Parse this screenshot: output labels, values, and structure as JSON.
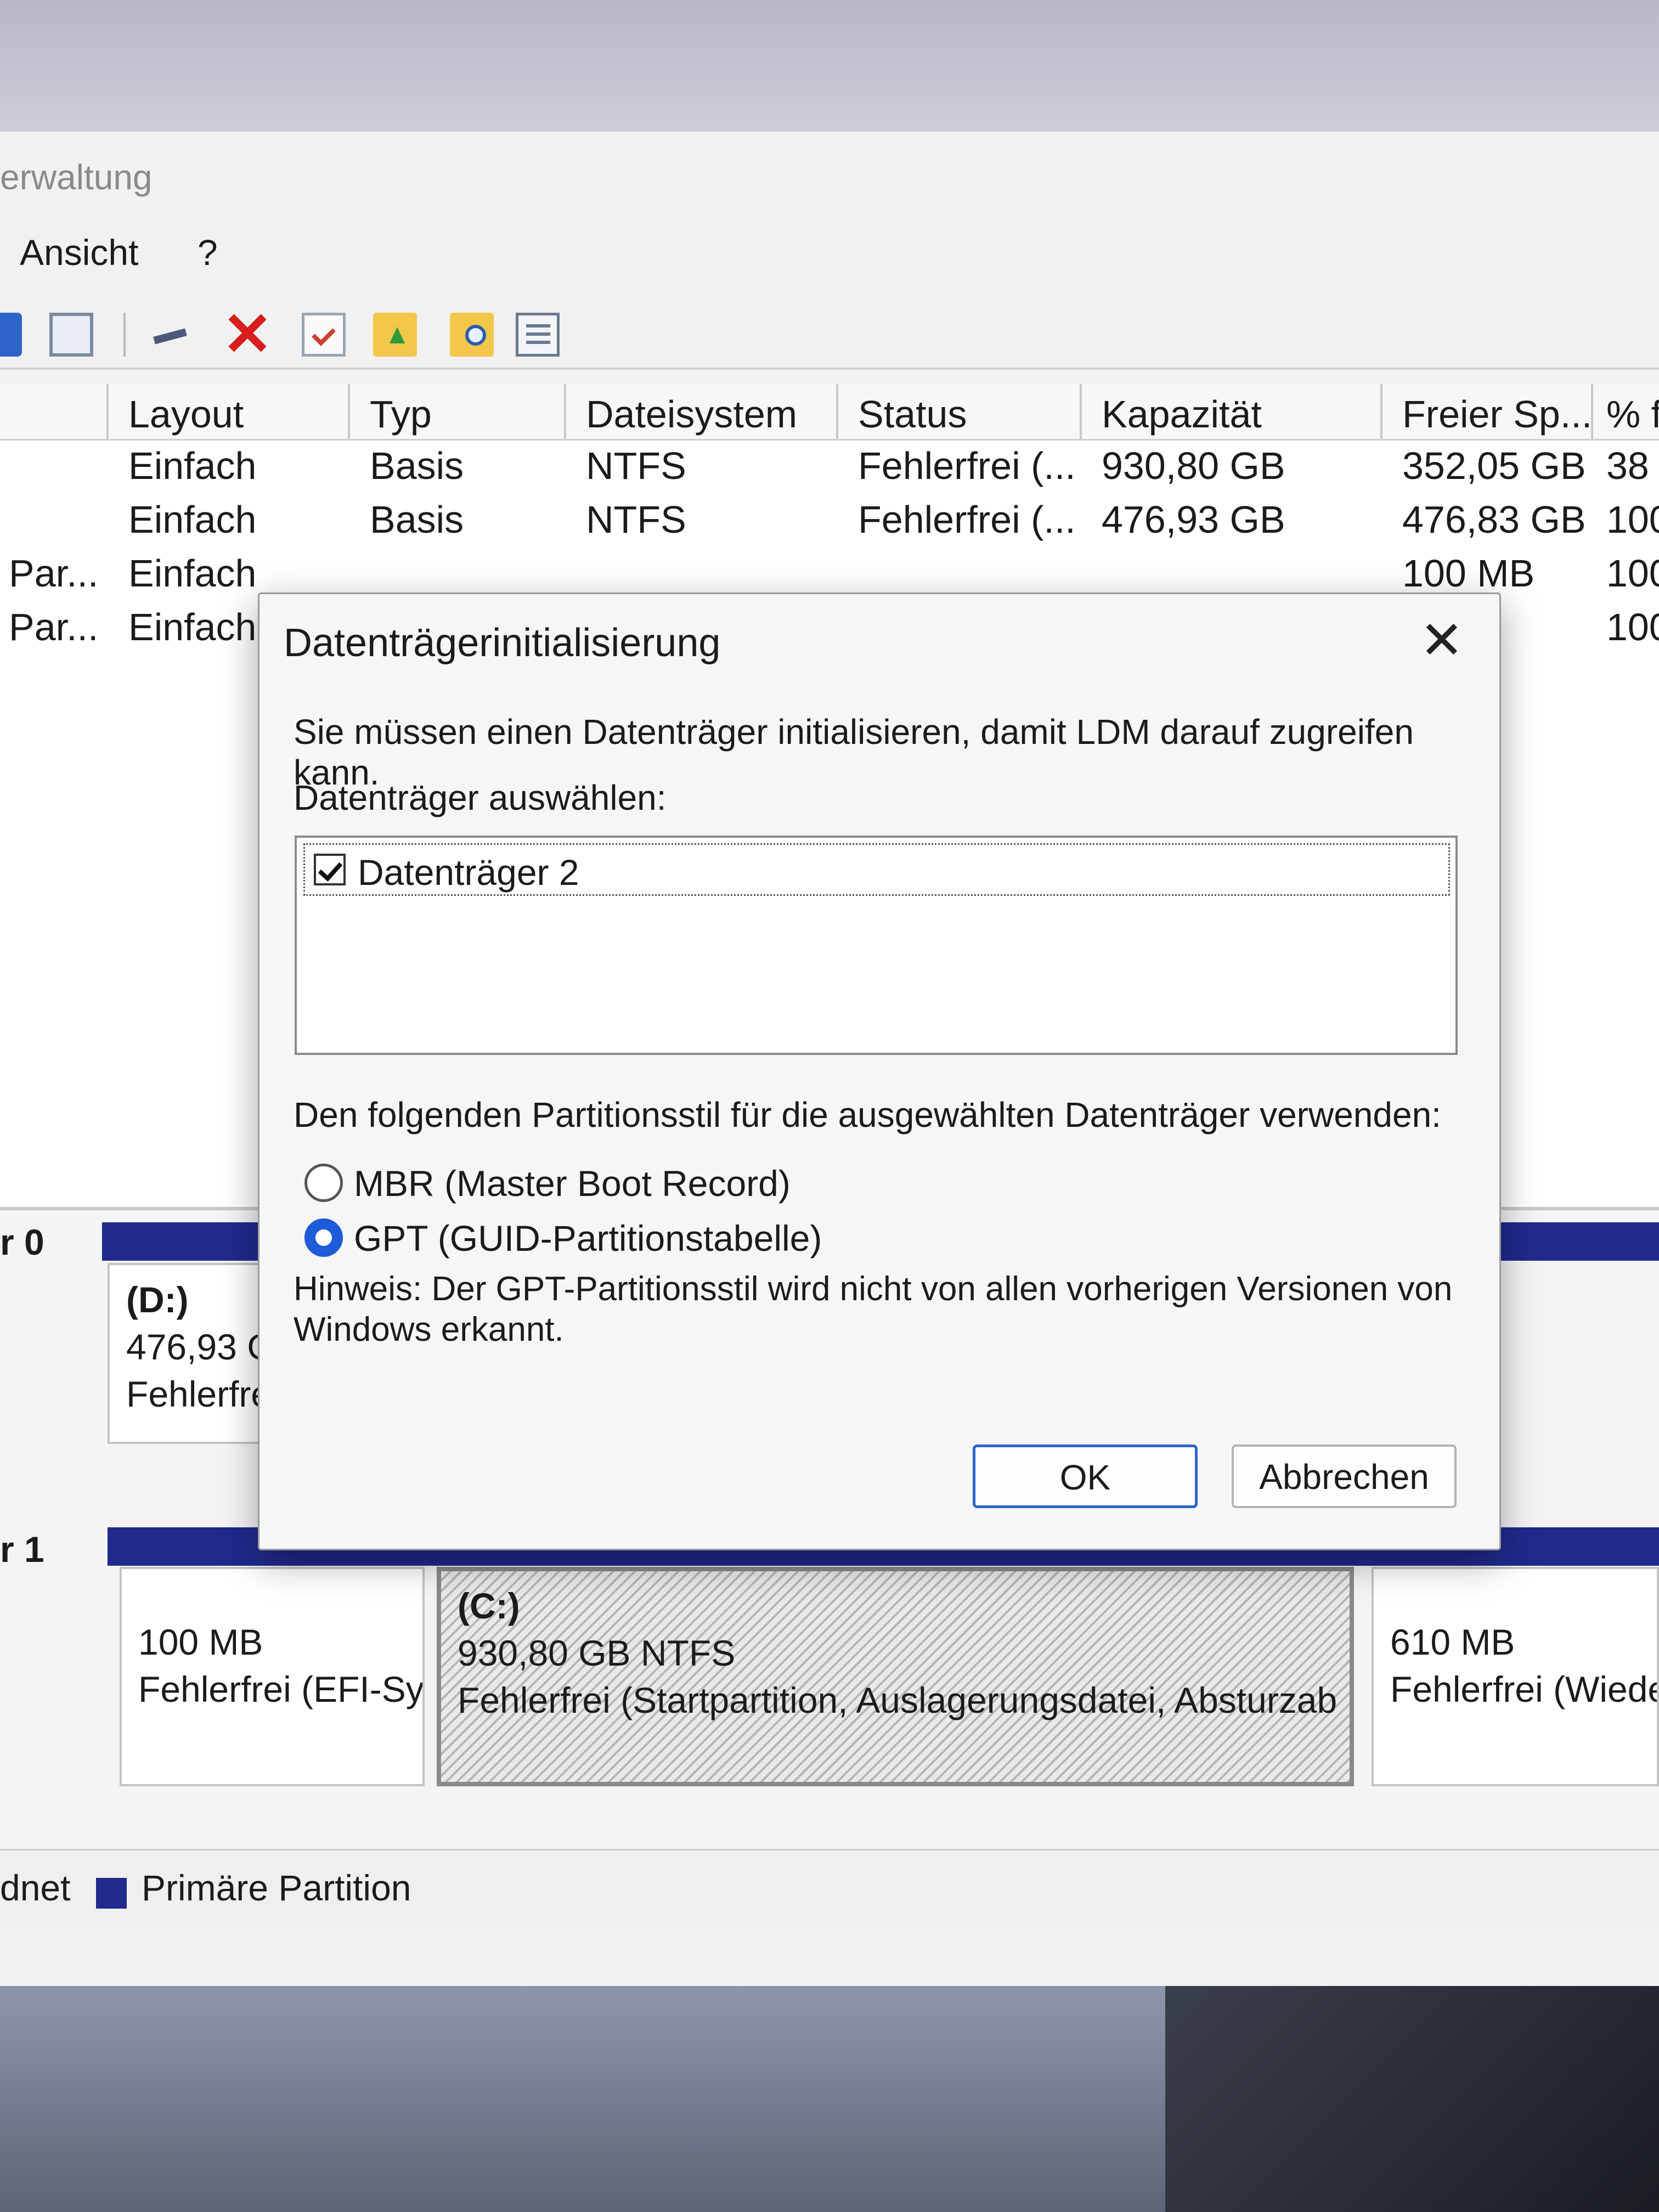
{
  "window": {
    "title_fragment": "erwaltung"
  },
  "menu": {
    "view": "Ansicht",
    "help": "?"
  },
  "volume_table": {
    "headers": [
      "Layout",
      "Typ",
      "Dateisystem",
      "Status",
      "Kapazität",
      "Freier Sp...",
      "% f"
    ],
    "rows": [
      {
        "name": "",
        "layout": "Einfach",
        "type": "Basis",
        "fs": "NTFS",
        "status": "Fehlerfrei (...",
        "capacity": "930,80 GB",
        "free": "352,05 GB",
        "pct": "38"
      },
      {
        "name": "",
        "layout": "Einfach",
        "type": "Basis",
        "fs": "NTFS",
        "status": "Fehlerfrei (...",
        "capacity": "476,93 GB",
        "free": "476,83 GB",
        "pct": "100"
      },
      {
        "name": "Par...",
        "layout": "Einfach",
        "type": "",
        "fs": "",
        "status": "",
        "capacity": "",
        "free": "100 MB",
        "pct": "100"
      },
      {
        "name": "Par...",
        "layout": "Einfach",
        "type": "",
        "fs": "",
        "status": "",
        "capacity": "",
        "free": "",
        "pct": "100"
      }
    ]
  },
  "disks": {
    "disk0": {
      "label": "r 0",
      "partition": {
        "name": "(D:)",
        "size": "476,93 G",
        "status": "Fehlerfre"
      }
    },
    "disk1": {
      "label": "r 1",
      "efi": {
        "size": "100 MB",
        "status": "Fehlerfrei (EFI-Sy"
      },
      "c": {
        "name": "(C:)",
        "size": "930,80 GB NTFS",
        "status": "Fehlerfrei (Startpartition, Auslagerungsdatei, Absturzab"
      },
      "recovery": {
        "size": "610 MB",
        "status": "Fehlerfrei (Wiede"
      }
    }
  },
  "legend": {
    "unallocated_fragment": "dnet",
    "primary": "Primäre Partition"
  },
  "dialog": {
    "title": "Datenträgerinitialisierung",
    "close_glyph": "✕",
    "message": "Sie müssen einen Datenträger initialisieren, damit LDM darauf zugreifen kann.",
    "select_label": "Datenträger auswählen:",
    "disk_item": "Datenträger 2",
    "disk_item_checked": true,
    "style_label": "Den folgenden Partitionsstil für die ausgewählten Datenträger verwenden:",
    "mbr_label": "MBR (Master Boot Record)",
    "gpt_label": "GPT (GUID-Partitionstabelle)",
    "selected_style": "GPT",
    "note": "Hinweis: Der GPT-Partitionsstil wird nicht von allen vorherigen Versionen von Windows erkannt.",
    "ok": "OK",
    "cancel": "Abbrechen"
  },
  "colors": {
    "primary_partition": "#1f2a8c",
    "accent": "#1d5bd8",
    "delete": "#d91c1c"
  },
  "icons": [
    "help-icon",
    "view-icon",
    "connect-icon",
    "delete-icon",
    "properties-icon",
    "folder-up-icon",
    "folder-search-icon",
    "list-icon",
    "close-icon",
    "checkbox-icon",
    "radio-icon"
  ]
}
